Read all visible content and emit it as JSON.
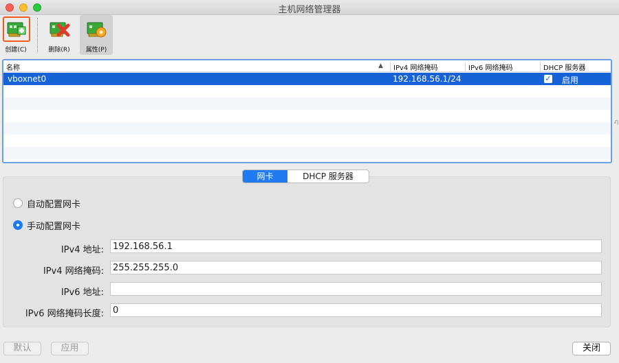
{
  "window": {
    "title": "主机网络管理器"
  },
  "toolbar": {
    "create_label": "创建(C)",
    "delete_label": "删除(R)",
    "properties_label": "属性(P)"
  },
  "table": {
    "columns": [
      "名称",
      "IPv4 网络掩码",
      "IPv6 网络掩码",
      "DHCP 服务器"
    ],
    "rows": [
      {
        "name": "vboxnet0",
        "ipv4_mask": "192.168.56.1/24",
        "ipv6_mask": "",
        "dhcp_enabled": true,
        "dhcp_label": "启用"
      }
    ]
  },
  "tabs": {
    "adapter": "网卡",
    "dhcp": "DHCP 服务器",
    "selected": "adapter"
  },
  "adapter": {
    "auto_label": "自动配置网卡",
    "manual_label": "手动配置网卡",
    "mode": "manual",
    "ipv4_address_label": "IPv4 地址:",
    "ipv4_address": "192.168.56.1",
    "ipv4_mask_label": "IPv4 网络掩码:",
    "ipv4_mask": "255.255.255.0",
    "ipv6_address_label": "IPv6 地址:",
    "ipv6_address": "",
    "ipv6_prefix_label": "IPv6 网络掩码长度:",
    "ipv6_prefix": "0"
  },
  "buttons": {
    "reset": "默认",
    "apply": "应用",
    "close": "关闭"
  },
  "colors": {
    "selection": "#1563d6",
    "accent": "#1f7bf2",
    "highlight_border": "#f05a1a"
  }
}
